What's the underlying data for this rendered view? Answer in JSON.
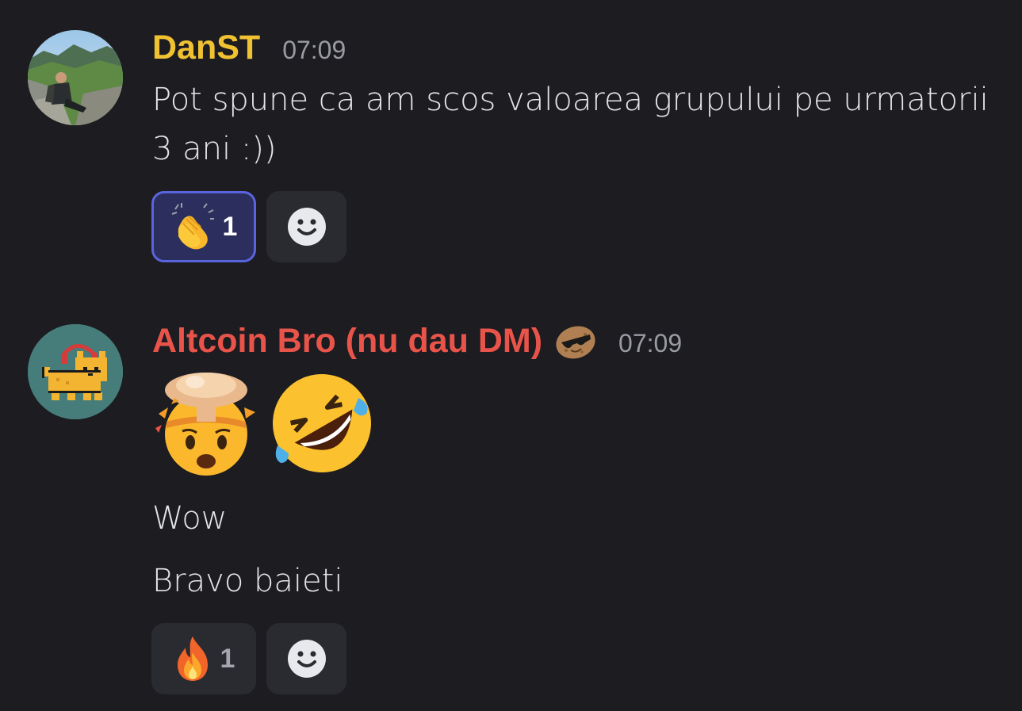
{
  "messages": [
    {
      "author": "DanST",
      "author_color": "#f0c232",
      "time": "07:09",
      "avatar": "landscape-photo-avatar",
      "text_lines": [
        "Pot spune ca am scos valoarea grupului pe urmatorii",
        "3 ani :))"
      ],
      "reactions": [
        {
          "emoji": "clapping-hands",
          "count": "1",
          "active": true
        }
      ]
    },
    {
      "author": "Altcoin Bro (nu dau DM)",
      "author_color": "#e8544a",
      "badge": "potato-sunglasses-emoji",
      "time": "07:09",
      "avatar": "pixel-cat-headphones-avatar",
      "emojis": [
        "exploding-head",
        "rolling-on-floor-laughing"
      ],
      "texts": [
        "Wow",
        "Bravo baieti"
      ],
      "reactions": [
        {
          "emoji": "fire",
          "count": "1",
          "active": false
        }
      ]
    }
  ],
  "colors": {
    "background": "#1c1c21",
    "reaction_active_border": "#5b64df",
    "reaction_active_bg": "#2c2f5e",
    "reaction_bg": "#2a2b31",
    "timestamp": "#9a9ca3"
  }
}
